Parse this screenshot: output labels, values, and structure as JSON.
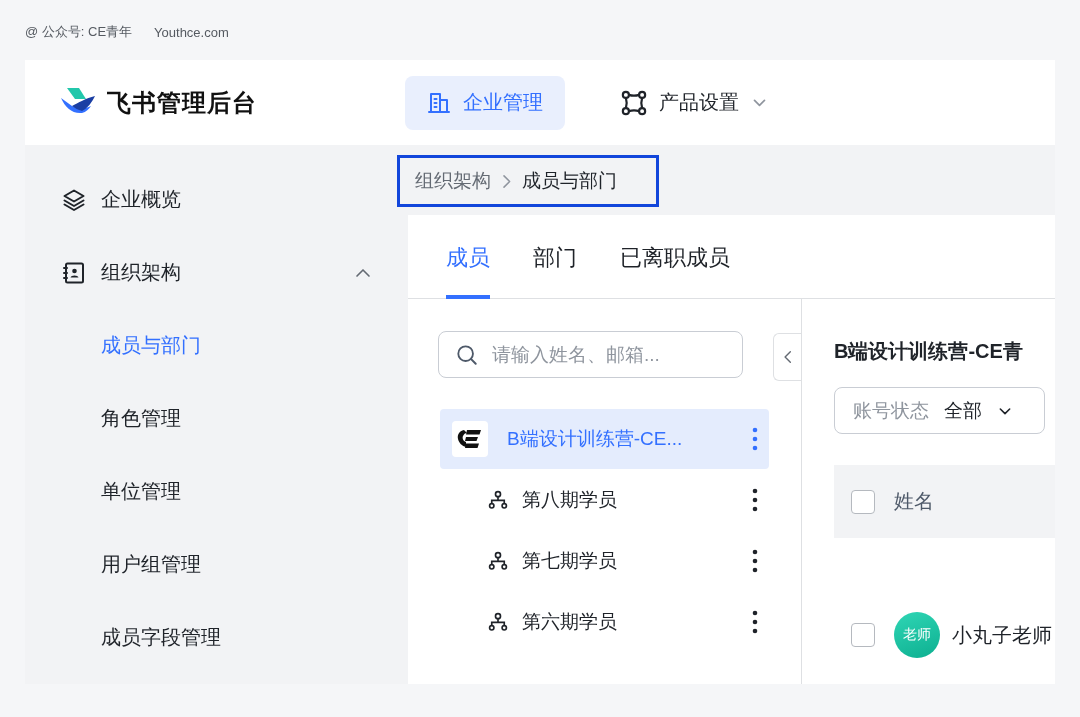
{
  "caption": {
    "handle": "@ 公众号: CE青年",
    "site": "Youthce.com"
  },
  "header": {
    "app_title": "飞书管理后台",
    "nav": [
      {
        "label": "企业管理",
        "selected": true,
        "dropdown": false
      },
      {
        "label": "产品设置",
        "selected": false,
        "dropdown": true
      }
    ]
  },
  "sidebar": {
    "items": [
      {
        "label": "企业概览",
        "selected": false
      },
      {
        "label": "组织架构",
        "selected": false,
        "expanded": true,
        "children": [
          {
            "label": "成员与部门",
            "selected": true
          },
          {
            "label": "角色管理",
            "selected": false
          },
          {
            "label": "单位管理",
            "selected": false
          },
          {
            "label": "用户组管理",
            "selected": false
          },
          {
            "label": "成员字段管理",
            "selected": false
          }
        ]
      }
    ]
  },
  "breadcrumb": {
    "highlighted": true,
    "items": [
      {
        "label": "组织架构",
        "current": false
      },
      {
        "label": "成员与部门",
        "current": true
      }
    ]
  },
  "tabs": [
    {
      "label": "成员",
      "selected": true
    },
    {
      "label": "部门",
      "selected": false
    },
    {
      "label": "已离职成员",
      "selected": false
    }
  ],
  "search": {
    "placeholder": "请输入姓名、邮箱..."
  },
  "org_tree": {
    "label": "B端设计训练营-CE...",
    "selected": true,
    "children": [
      {
        "label": "第八期学员",
        "selected": false
      },
      {
        "label": "第七期学员",
        "selected": false
      },
      {
        "label": "第六期学员",
        "selected": false
      }
    ]
  },
  "department": {
    "title": "B端设计训练营-CE青",
    "filter": {
      "label": "账号状态",
      "value": "全部"
    },
    "table": {
      "columns": [
        "姓名"
      ],
      "all_checked": false,
      "rows": [
        {
          "checked": false,
          "avatar_text": "老师",
          "name": "小丸子老师"
        }
      ]
    }
  }
}
